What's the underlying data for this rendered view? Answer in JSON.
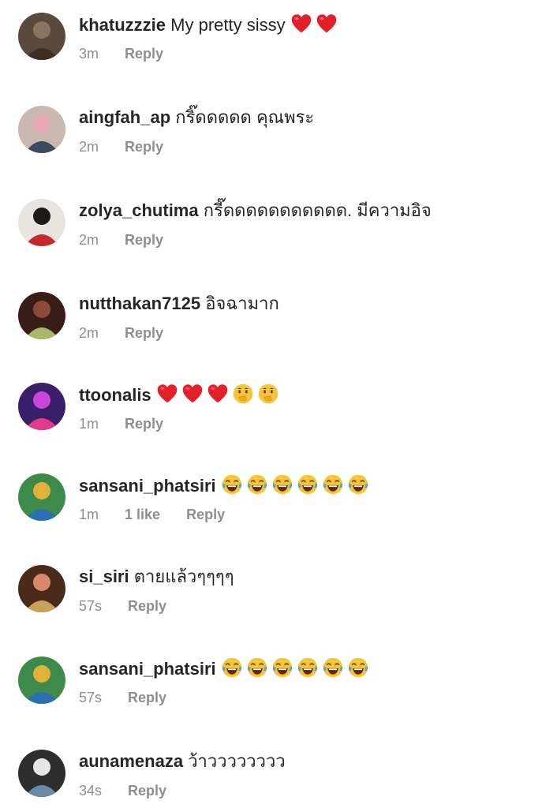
{
  "comments": [
    {
      "username": "khatuzzzie",
      "text": "My pretty sissy",
      "emojis": [
        "red-heart",
        "red-heart"
      ],
      "time": "3m",
      "likes": "",
      "reply": "Reply",
      "avatar_colors": [
        "#5a4a3c",
        "#8a7560",
        "#3b2e25"
      ]
    },
    {
      "username": "aingfah_ap",
      "text": "กริ๊ดดดดด คุณพระ",
      "emojis": [],
      "time": "2m",
      "likes": "",
      "reply": "Reply",
      "avatar_colors": [
        "#c9b7b0",
        "#e7a9b6",
        "#3a4a5f"
      ]
    },
    {
      "username": "zolya_chutima",
      "text": "กรี๊ดดดดดดดดดดด. มีความอิจ",
      "emojis": [],
      "time": "2m",
      "likes": "",
      "reply": "Reply",
      "avatar_colors": [
        "#e8e4e0",
        "#1e1a18",
        "#c22a2e"
      ]
    },
    {
      "username": "nutthakan7125",
      "text": "อิจฉามาก",
      "emojis": [],
      "time": "2m",
      "likes": "",
      "reply": "Reply",
      "avatar_colors": [
        "#3b1d18",
        "#8c4a3a",
        "#a8b86a"
      ]
    },
    {
      "username": "ttoonalis",
      "text": "",
      "emojis": [
        "red-heart",
        "red-heart",
        "red-heart",
        "shushing-face",
        "shushing-face"
      ],
      "time": "1m",
      "likes": "",
      "reply": "Reply",
      "avatar_colors": [
        "#3a1f6b",
        "#c946d6",
        "#e23a8a"
      ]
    },
    {
      "username": "sansani_phatsiri",
      "text": "",
      "emojis": [
        "tears-of-joy",
        "tears-of-joy",
        "tears-of-joy",
        "tears-of-joy",
        "tears-of-joy",
        "tears-of-joy"
      ],
      "time": "1m",
      "likes": "1 like",
      "reply": "Reply",
      "avatar_colors": [
        "#3e8a4a",
        "#e0b23a",
        "#2a6fb0"
      ]
    },
    {
      "username": "si_siri",
      "text": "ตายแล้วๆๆๆๆ",
      "emojis": [],
      "time": "57s",
      "likes": "",
      "reply": "Reply",
      "avatar_colors": [
        "#4a2a1a",
        "#d68a6a",
        "#c9a25a"
      ]
    },
    {
      "username": "sansani_phatsiri",
      "text": "",
      "emojis": [
        "tears-of-joy",
        "tears-of-joy",
        "tears-of-joy",
        "tears-of-joy",
        "tears-of-joy",
        "tears-of-joy"
      ],
      "time": "57s",
      "likes": "",
      "reply": "Reply",
      "avatar_colors": [
        "#3e8a4a",
        "#e0b23a",
        "#2a6fb0"
      ]
    },
    {
      "username": "aunamenaza",
      "text": "ว้าวววววววว",
      "emojis": [],
      "time": "34s",
      "likes": "",
      "reply": "Reply",
      "avatar_colors": [
        "#2e2e2e",
        "#e6e6e6",
        "#6a8aa8"
      ]
    }
  ]
}
